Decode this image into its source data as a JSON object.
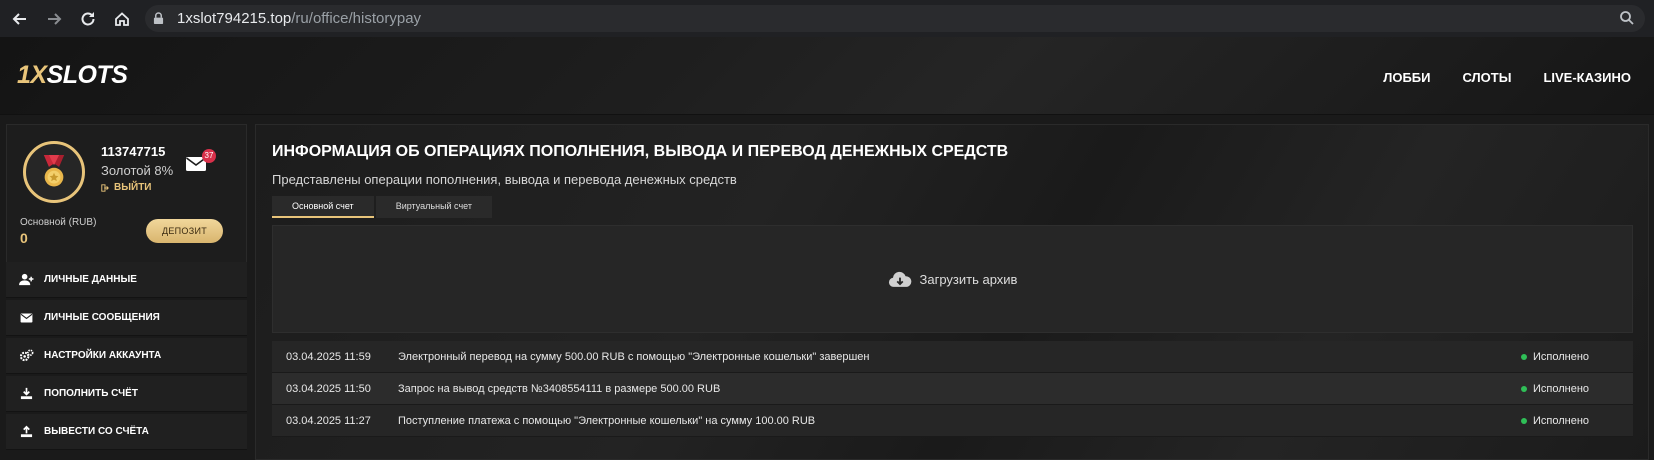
{
  "browser": {
    "url_host": "1xslot794215.top",
    "url_path": "/ru/office/historypay"
  },
  "header": {
    "logo_part1": "1X",
    "logo_part2": "SLOTS",
    "nav": [
      "ЛОББИ",
      "СЛОТЫ",
      "LIVE-КАЗИНО"
    ]
  },
  "profile": {
    "user_id": "113747715",
    "level": "Золотой 8%",
    "logout_label": "ВЫЙТИ",
    "messages_count": "37",
    "balance_label": "Основной (RUB)",
    "balance_value": "0",
    "deposit_label": "ДЕПОЗИТ"
  },
  "sidebar": {
    "items": [
      {
        "label": "ЛИЧНЫЕ ДАННЫЕ",
        "icon": "user-plus-icon"
      },
      {
        "label": "ЛИЧНЫЕ СООБЩЕНИЯ",
        "icon": "envelope-icon"
      },
      {
        "label": "НАСТРОЙКИ АККАУНТА",
        "icon": "gears-icon"
      },
      {
        "label": "ПОПОЛНИТЬ СЧЁТ",
        "icon": "download-icon"
      },
      {
        "label": "ВЫВЕСТИ СО СЧЁТА",
        "icon": "upload-icon"
      }
    ]
  },
  "main": {
    "title": "ИНФОРМАЦИЯ ОБ ОПЕРАЦИЯХ ПОПОЛНЕНИЯ, ВЫВОДА И ПЕРЕВОД ДЕНЕЖНЫХ СРЕДСТВ",
    "subtitle": "Представлены операции пополнения, вывода и перевода денежных средств",
    "tabs": [
      {
        "label": "Основной счет",
        "active": true
      },
      {
        "label": "Виртуальный счет",
        "active": false
      }
    ],
    "archive_label": "Загрузить архив",
    "transactions": [
      {
        "date": "03.04.2025 11:59",
        "description": "Электронный перевод на сумму 500.00 RUB с помощью \"Электронные кошельки\" завершен",
        "status": "Исполнено"
      },
      {
        "date": "03.04.2025 11:50",
        "description": "Запрос на вывод средств №3408554111 в размере 500.00 RUB",
        "status": "Исполнено"
      },
      {
        "date": "03.04.2025 11:27",
        "description": "Поступление платежа с помощью \"Электронные кошельки\" на сумму 100.00 RUB",
        "status": "Исполнено"
      }
    ]
  },
  "colors": {
    "accent_gold": "#e8c47a",
    "status_green": "#2fbf57",
    "badge_red": "#d9304a"
  }
}
